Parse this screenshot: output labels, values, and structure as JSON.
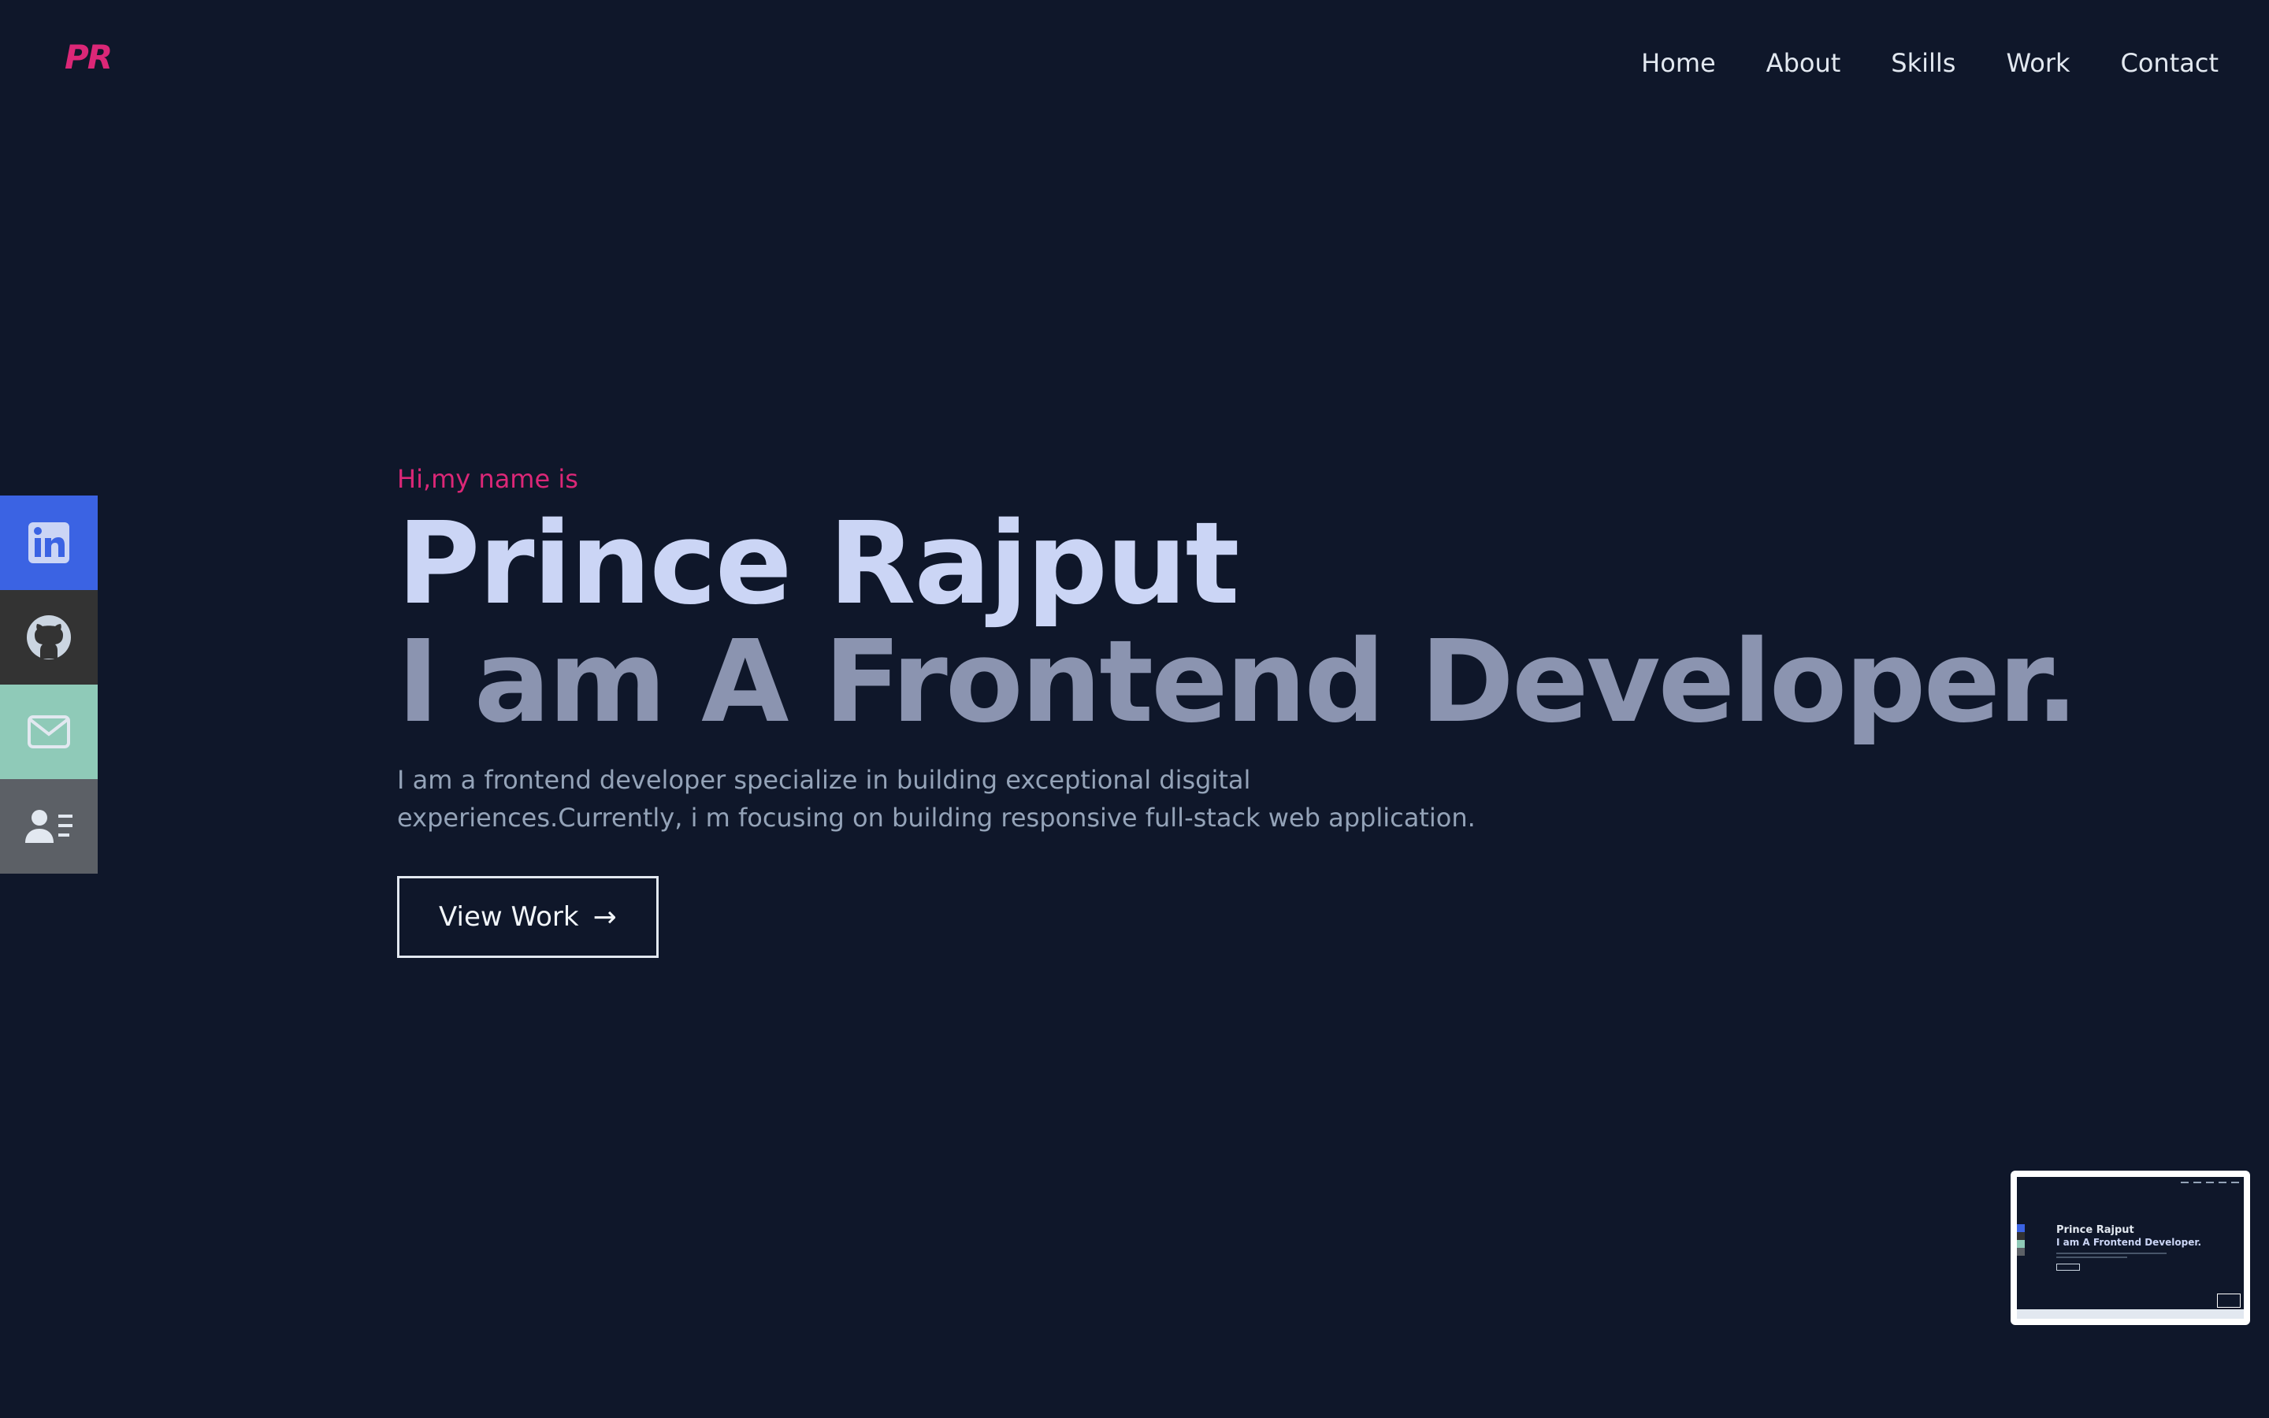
{
  "header": {
    "logo": "PR",
    "nav": [
      "Home",
      "About",
      "Skills",
      "Work",
      "Contact"
    ]
  },
  "social": [
    {
      "name": "linkedin-icon",
      "color": "#3b63e3"
    },
    {
      "name": "github-icon",
      "color": "#333333"
    },
    {
      "name": "mail-icon",
      "color": "#8fcab8"
    },
    {
      "name": "contact-card-icon",
      "color": "#5c6066"
    }
  ],
  "hero": {
    "greeting": "Hi,my name is",
    "name": "Prince Rajput",
    "role": "I am A Frontend Developer.",
    "description": "I am a frontend developer specialize in building exceptional disgital experiences.Currently, i m focusing on building responsive full-stack web application.",
    "cta_label": "View Work",
    "cta_arrow": "→"
  },
  "preview": {
    "name": "Prince Rajput",
    "role": "I am A Frontend Developer."
  },
  "colors": {
    "background": "#0f172a",
    "accent": "#db2777",
    "name": "#cbd5f5",
    "role": "#8b94b0",
    "text_muted": "#94a3b8"
  }
}
